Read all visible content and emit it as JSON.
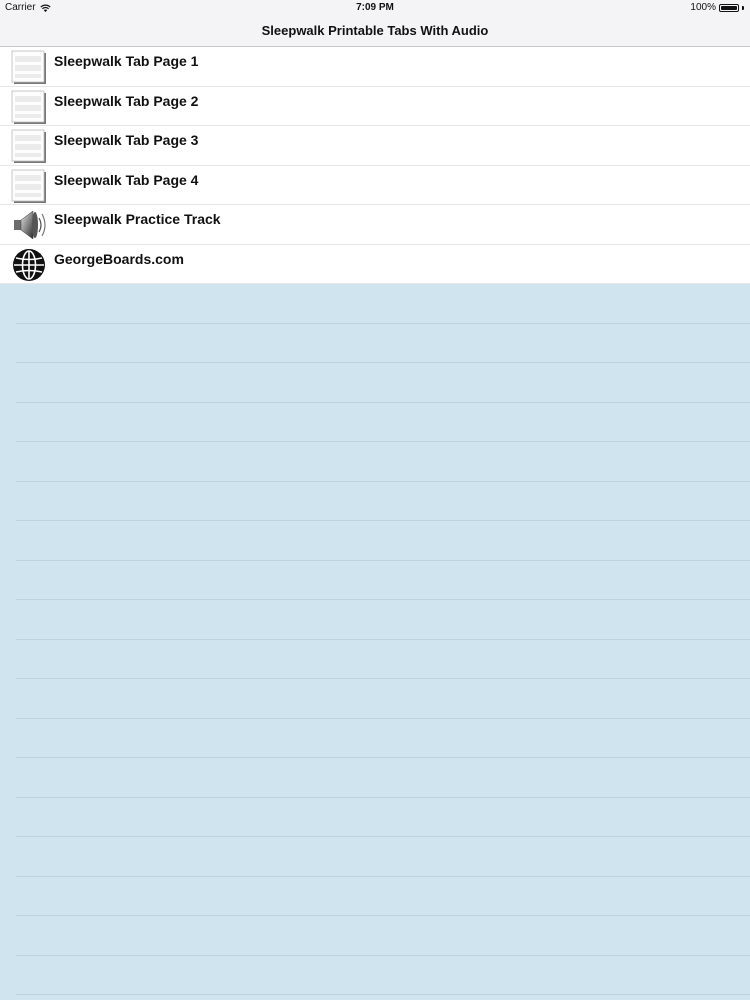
{
  "status_bar": {
    "carrier": "Carrier",
    "time": "7:09 PM",
    "battery": "100%"
  },
  "nav": {
    "title": "Sleepwalk Printable Tabs With Audio"
  },
  "rows": [
    {
      "label": "Sleepwalk Tab Page 1",
      "icon": "tab-sheet-icon"
    },
    {
      "label": "Sleepwalk Tab Page 2",
      "icon": "tab-sheet-icon"
    },
    {
      "label": "Sleepwalk Tab Page 3",
      "icon": "tab-sheet-icon"
    },
    {
      "label": "Sleepwalk Tab Page 4",
      "icon": "tab-sheet-icon"
    },
    {
      "label": "Sleepwalk Practice Track",
      "icon": "speaker-icon"
    },
    {
      "label": "GeorgeBoards.com",
      "icon": "globe-icon"
    }
  ],
  "colors": {
    "background": "#cfe4ef",
    "bar": "#f4f4f6",
    "row": "#ffffff"
  }
}
